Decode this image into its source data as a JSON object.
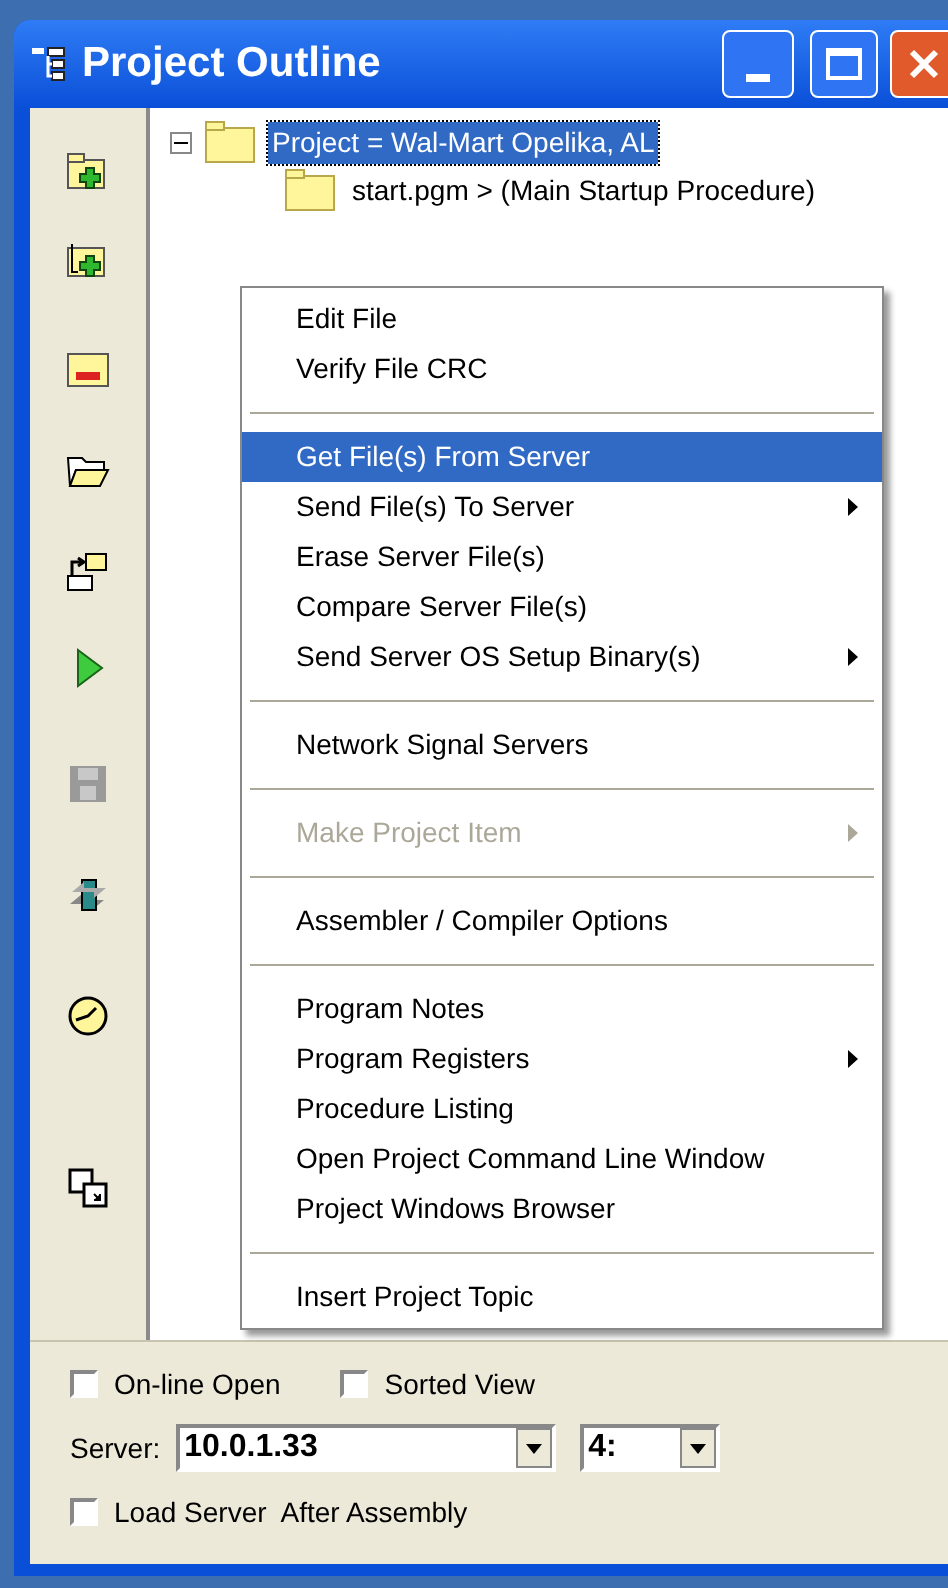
{
  "window": {
    "title": "Project Outline"
  },
  "tree": [
    {
      "label": "Project = Wal-Mart Opelika, AL",
      "expanded": true,
      "selected": true,
      "children": [
        {
          "label": "start.pgm > (Main Startup Procedure)",
          "selected": false
        }
      ]
    }
  ],
  "context_menu": [
    {
      "kind": "item",
      "label": "Edit File",
      "selected": false,
      "disabled": false,
      "submenu": false
    },
    {
      "kind": "item",
      "label": "Verify File CRC",
      "selected": false,
      "disabled": false,
      "submenu": false
    },
    {
      "kind": "separator"
    },
    {
      "kind": "item",
      "label": "Get File(s) From Server",
      "selected": true,
      "disabled": false,
      "submenu": false
    },
    {
      "kind": "item",
      "label": "Send File(s) To Server",
      "selected": false,
      "disabled": false,
      "submenu": true
    },
    {
      "kind": "item",
      "label": "Erase Server File(s)",
      "selected": false,
      "disabled": false,
      "submenu": false
    },
    {
      "kind": "item",
      "label": "Compare Server File(s)",
      "selected": false,
      "disabled": false,
      "submenu": false
    },
    {
      "kind": "item",
      "label": "Send Server OS Setup Binary(s)",
      "selected": false,
      "disabled": false,
      "submenu": true
    },
    {
      "kind": "separator"
    },
    {
      "kind": "item",
      "label": "Network Signal Servers",
      "selected": false,
      "disabled": false,
      "submenu": false
    },
    {
      "kind": "separator"
    },
    {
      "kind": "item",
      "label": "Make Project Item",
      "selected": false,
      "disabled": true,
      "submenu": true
    },
    {
      "kind": "separator"
    },
    {
      "kind": "item",
      "label": "Assembler / Compiler Options",
      "selected": false,
      "disabled": false,
      "submenu": false
    },
    {
      "kind": "separator"
    },
    {
      "kind": "item",
      "label": "Program Notes",
      "selected": false,
      "disabled": false,
      "submenu": false
    },
    {
      "kind": "item",
      "label": "Program Registers",
      "selected": false,
      "disabled": false,
      "submenu": true
    },
    {
      "kind": "item",
      "label": "Procedure Listing",
      "selected": false,
      "disabled": false,
      "submenu": false
    },
    {
      "kind": "item",
      "label": "Open Project Command Line Window",
      "selected": false,
      "disabled": false,
      "submenu": false
    },
    {
      "kind": "item",
      "label": "Project Windows Browser",
      "selected": false,
      "disabled": false,
      "submenu": false
    },
    {
      "kind": "separator"
    },
    {
      "kind": "item",
      "label": "Insert Project Topic",
      "selected": false,
      "disabled": false,
      "submenu": false
    }
  ],
  "options": [
    {
      "label": "On-line Open",
      "checked": false
    },
    {
      "label": "Sorted View",
      "checked": false
    }
  ],
  "server": {
    "label": "Server:",
    "value": "10.0.1.33",
    "port": "4:"
  },
  "load_option": {
    "label": "Load Server  After Assembly",
    "checked": false
  }
}
